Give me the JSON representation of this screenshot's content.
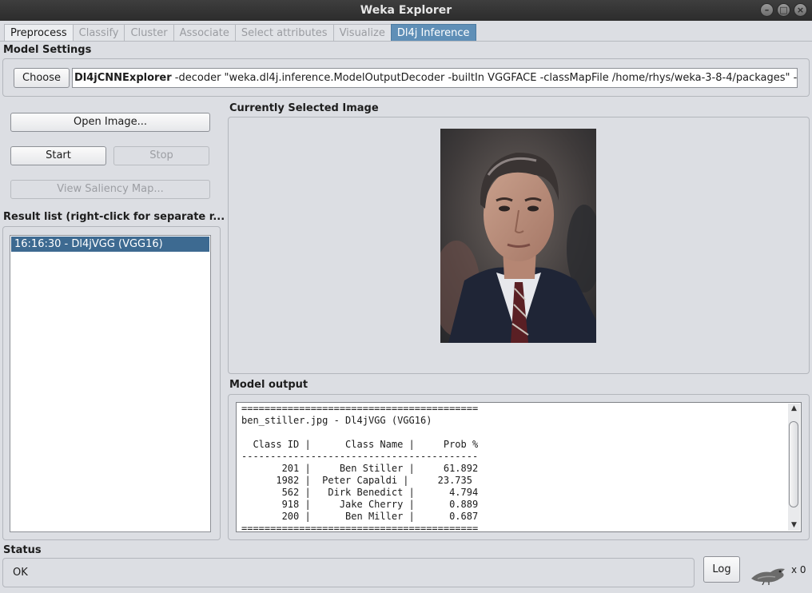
{
  "window": {
    "title": "Weka Explorer"
  },
  "tabs": [
    {
      "label": "Preprocess",
      "state": "enabled"
    },
    {
      "label": "Classify",
      "state": "disabled"
    },
    {
      "label": "Cluster",
      "state": "disabled"
    },
    {
      "label": "Associate",
      "state": "disabled"
    },
    {
      "label": "Select attributes",
      "state": "disabled"
    },
    {
      "label": "Visualize",
      "state": "disabled"
    },
    {
      "label": "Dl4j Inference",
      "state": "active"
    }
  ],
  "model_settings": {
    "label": "Model Settings",
    "choose_label": "Choose",
    "command_name": "Dl4jCNNExplorer",
    "command_args": " -decoder \"weka.dl4j.inference.ModelOutputDecoder -builtIn VGGFACE -classMapFile /home/rhys/weka-3-8-4/packages\" -saliency"
  },
  "controls": {
    "open_image_label": "Open Image...",
    "start_label": "Start",
    "stop_label": "Stop",
    "saliency_label": "View Saliency Map..."
  },
  "result_list": {
    "label": "Result list (right-click for separate r...",
    "items": [
      "16:16:30 - Dl4jVGG (VGG16)"
    ]
  },
  "image_panel": {
    "label": "Currently Selected Image"
  },
  "model_output": {
    "label": "Model output",
    "text": "=========================================\nben_stiller.jpg - Dl4jVGG (VGG16)\n\n  Class ID |      Class Name |     Prob %\n-----------------------------------------\n       201 |     Ben Stiller |     61.892\n      1982 |  Peter Capaldi |     23.735\n       562 |   Dirk Benedict |      4.794\n       918 |     Jake Cherry |      0.889\n       200 |      Ben Miller |      0.687\n========================================="
  },
  "status": {
    "label": "Status",
    "text": "OK",
    "log_label": "Log",
    "task_count": "x 0"
  },
  "icons": {
    "status_icon": "weka-bird-icon"
  }
}
